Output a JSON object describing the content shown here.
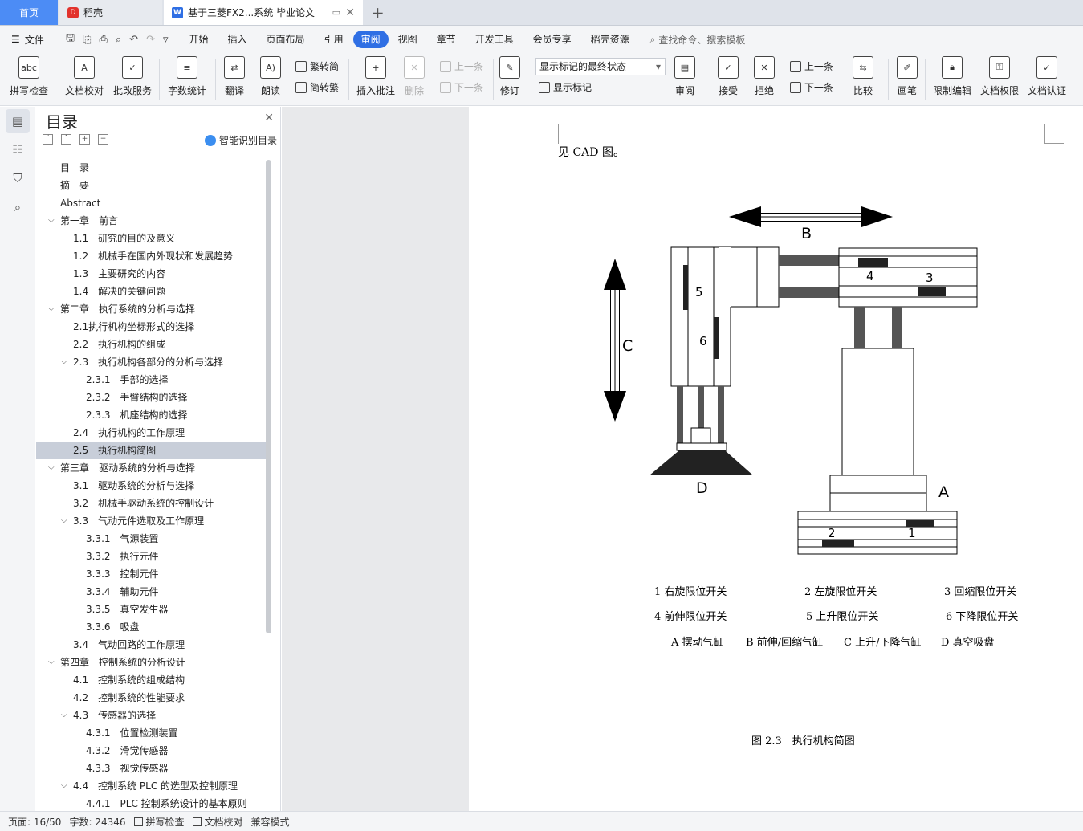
{
  "tabs": {
    "home": "首页",
    "daoke": "稻壳",
    "doc": "基于三菱FX2...系统 毕业论文",
    "add": "+"
  },
  "menu": {
    "file": "文件",
    "tabs": [
      "开始",
      "插入",
      "页面布局",
      "引用",
      "审阅",
      "视图",
      "章节",
      "开发工具",
      "会员专享",
      "稻壳资源"
    ],
    "active_tab": "审阅",
    "search": "查找命令、搜索模板"
  },
  "ribbon": {
    "spellcheck": "拼写检查",
    "proofread": "文档校对",
    "revise_service": "批改服务",
    "word_count": "字数统计",
    "translate": "翻译",
    "read_aloud": "朗读",
    "trad": "繁转简",
    "simp": "简转繁",
    "insert_comment": "插入批注",
    "delete": "删除",
    "prev_comment": "上一条",
    "next_comment": "下一条",
    "track": "修订",
    "display_select": "显示标记的最终状态",
    "show_markup": "显示标记",
    "review": "审阅",
    "accept": "接受",
    "reject": "拒绝",
    "prev_change": "上一条",
    "next_change": "下一条",
    "compare": "比较",
    "pen": "画笔",
    "restrict": "限制编辑",
    "permission": "文档权限",
    "certify": "文档认证"
  },
  "toc": {
    "title": "目录",
    "smart": "智能识别目录",
    "items": [
      {
        "text": "目　录",
        "level": 0
      },
      {
        "text": "摘　要",
        "level": 0
      },
      {
        "text": "Abstract",
        "level": 0
      },
      {
        "text": "第一章　前言",
        "level": 0,
        "expand": true
      },
      {
        "text": "1.1　研究的目的及意义",
        "level": 1
      },
      {
        "text": "1.2　机械手在国内外现状和发展趋势",
        "level": 1
      },
      {
        "text": "1.3　主要研究的内容",
        "level": 1
      },
      {
        "text": "1.4　解决的关键问题",
        "level": 1
      },
      {
        "text": "第二章　执行系统的分析与选择",
        "level": 0,
        "expand": true
      },
      {
        "text": "2.1执行机构坐标形式的选择",
        "level": 1
      },
      {
        "text": "2.2　执行机构的组成",
        "level": 1
      },
      {
        "text": "2.3　执行机构各部分的分析与选择",
        "level": 1,
        "expand": true
      },
      {
        "text": "2.3.1　手部的选择",
        "level": 2
      },
      {
        "text": "2.3.2　手臂结构的选择",
        "level": 2
      },
      {
        "text": "2.3.3　机座结构的选择",
        "level": 2
      },
      {
        "text": "2.4　执行机构的工作原理",
        "level": 1
      },
      {
        "text": "2.5　执行机构简图",
        "level": 1,
        "selected": true
      },
      {
        "text": "第三章　驱动系统的分析与选择",
        "level": 0,
        "expand": true
      },
      {
        "text": "3.1　驱动系统的分析与选择",
        "level": 1
      },
      {
        "text": "3.2　机械手驱动系统的控制设计",
        "level": 1
      },
      {
        "text": "3.3　气动元件选取及工作原理",
        "level": 1,
        "expand": true
      },
      {
        "text": "3.3.1　气源装置",
        "level": 2
      },
      {
        "text": "3.3.2　执行元件",
        "level": 2
      },
      {
        "text": "3.3.3　控制元件",
        "level": 2
      },
      {
        "text": "3.3.4　辅助元件",
        "level": 2
      },
      {
        "text": "3.3.5　真空发生器",
        "level": 2
      },
      {
        "text": "3.3.6　吸盘",
        "level": 2
      },
      {
        "text": "3.4　气动回路的工作原理",
        "level": 1
      },
      {
        "text": "第四章　控制系统的分析设计",
        "level": 0,
        "expand": true
      },
      {
        "text": "4.1　控制系统的组成结构",
        "level": 1
      },
      {
        "text": "4.2　控制系统的性能要求",
        "level": 1
      },
      {
        "text": "4.3　传感器的选择",
        "level": 1,
        "expand": true
      },
      {
        "text": "4.3.1　位置检测装置",
        "level": 2
      },
      {
        "text": "4.3.2　滑觉传感器",
        "level": 2
      },
      {
        "text": "4.3.3　视觉传感器",
        "level": 2
      },
      {
        "text": "4.4　控制系统 PLC 的选型及控制原理",
        "level": 1,
        "expand": true
      },
      {
        "text": "4.4.1　PLC 控制系统设计的基本原则",
        "level": 2
      }
    ]
  },
  "doc": {
    "intro": "见 CAD 图。",
    "labels": {
      "A": "A",
      "B": "B",
      "C": "C",
      "D": "D",
      "n1": "1",
      "n2": "2",
      "n3": "3",
      "n4": "4",
      "n5": "5",
      "n6": "6"
    },
    "legend": [
      "1 右旋限位开关",
      "2  左旋限位开关",
      "3  回缩限位开关",
      "4  前伸限位开关",
      "5  上升限位开关",
      "6  下降限位开关",
      "A  摆动气缸",
      "B 前伸/回缩气缸",
      "C 上升/下降气缸",
      "D  真空吸盘"
    ],
    "caption": "图 2.3　执行机构简图"
  },
  "status": {
    "page": "页面: 16/50",
    "words": "字数: 24346",
    "spell": "拼写检查",
    "proof": "文档校对",
    "compat": "兼容模式"
  }
}
